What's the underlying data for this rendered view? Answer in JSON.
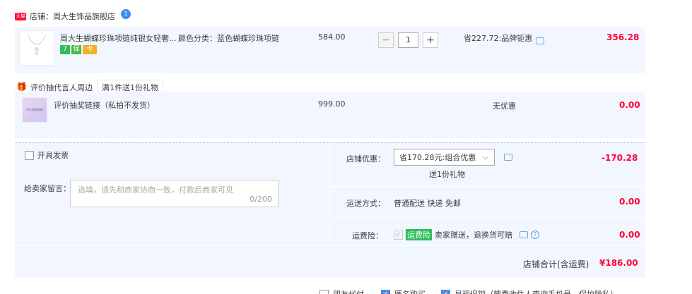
{
  "shop": {
    "badge": "天猫",
    "label": "店铺：周大生饰品旗舰店",
    "ww": "1"
  },
  "item": {
    "title": "周大生蝴蝶珍珠项链纯银女轻奢...",
    "sku": "颜色分类：蓝色蝴蝶珍珠项链",
    "unit_price": "584.00",
    "quantity": "1",
    "minus": "−",
    "plus": "+",
    "discount": "省227.72:品牌钜惠",
    "subtotal": "356.28",
    "badges": [
      "7",
      "保",
      "卡"
    ]
  },
  "gift": {
    "promo_label": "评价抽代言人周边",
    "promo_tag": "满1件送1份礼物",
    "title": "评价抽奖链接（私拍不发货）",
    "unit_price": "999.00",
    "discount": "无优惠",
    "subtotal": "0.00",
    "thumb_text": "评价抽奖链接"
  },
  "invoice": {
    "label": "开具发票"
  },
  "message": {
    "label": "给卖家留言：",
    "placeholder": "选填，请先和商家协商一致，付款后商家可见",
    "counter": "0/200"
  },
  "shop_discount": {
    "label": "店铺优惠：",
    "selected": "省170.28元:组合优惠",
    "chevron": "⌵",
    "sub": "送1份礼物",
    "amount": "-170.28"
  },
  "shipping": {
    "label": "运送方式：",
    "value": "普通配送 快递 免邮",
    "amount": "0.00"
  },
  "insurance": {
    "label": "运费险：",
    "tag": "运费险",
    "text": "卖家赠送，退换货可赔",
    "help": "?",
    "amount": "0.00"
  },
  "total": {
    "label": "店铺合计(含运费)",
    "amount": "¥186.00"
  },
  "bottom_options": [
    "朋友代付",
    "匿名购买",
    "显现促销（营费收件人查询手机号，保护隐私）"
  ],
  "colors": {
    "accent_red": "#ff0036",
    "row_bg": "#f2f7ff",
    "link_blue": "#3d8df5"
  }
}
